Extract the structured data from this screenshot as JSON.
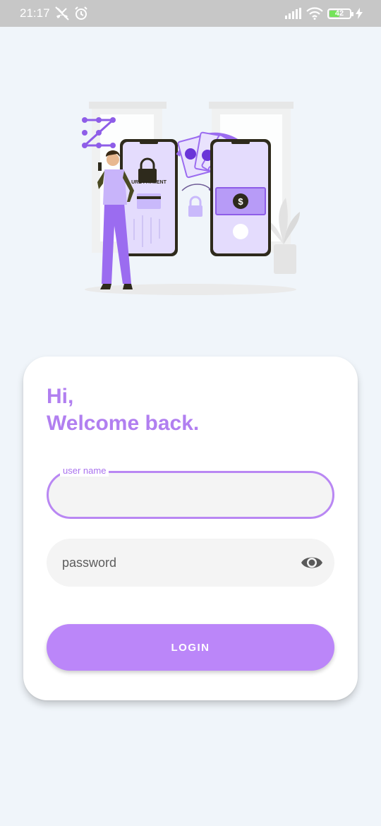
{
  "status_bar": {
    "time": "21:17",
    "icons": [
      "missed-call-icon",
      "alarm-icon",
      "signal-icon",
      "wifi-icon",
      "battery-icon",
      "charging-icon"
    ],
    "battery_level": "42"
  },
  "illustration": {
    "phone_label": "URE PAYMENT",
    "currency_symbol": "$",
    "accent_color": "#9b6cf0"
  },
  "login_card": {
    "greeting_line1": "Hi,",
    "greeting_line2": "Welcome back.",
    "username": {
      "label": "user name",
      "value": ""
    },
    "password": {
      "placeholder": "password",
      "value": ""
    },
    "login_label": "LOGIN"
  },
  "colors": {
    "accent": "#bb86f9",
    "heading": "#b17ff0",
    "background": "#f0f5fa",
    "status_bar": "#c7c7c7"
  }
}
